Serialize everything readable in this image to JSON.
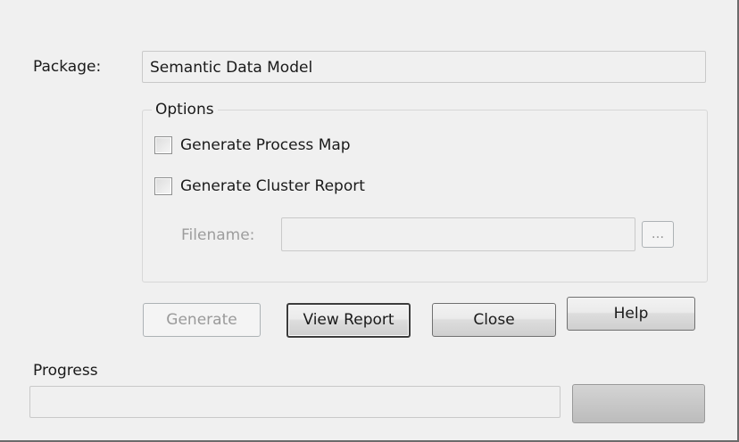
{
  "package": {
    "label": "Package:",
    "value": "Semantic Data Model"
  },
  "options": {
    "title": "Options",
    "generate_process_map": {
      "label": "Generate Process Map",
      "checked": false
    },
    "generate_cluster_report": {
      "label": "Generate Cluster Report",
      "checked": false
    },
    "filename": {
      "label": "Filename:",
      "value": "",
      "browse_label": "..."
    }
  },
  "buttons": {
    "generate": "Generate",
    "view_report": "View Report",
    "close": "Close",
    "help": "Help"
  },
  "progress": {
    "label": "Progress",
    "value": 0
  }
}
